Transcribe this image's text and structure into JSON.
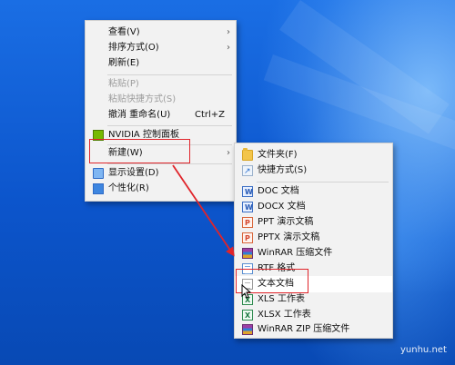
{
  "desktop_menu": {
    "items": [
      {
        "label": "查看(V)",
        "has_submenu": true
      },
      {
        "label": "排序方式(O)",
        "has_submenu": true
      },
      {
        "label": "刷新(E)"
      },
      {
        "label": "粘贴(P)",
        "disabled": true
      },
      {
        "label": "粘贴快捷方式(S)",
        "disabled": true
      },
      {
        "label": "撤消 重命名(U)",
        "shortcut": "Ctrl+Z"
      },
      {
        "label": "NVIDIA 控制面板",
        "icon": "nvidia-icon"
      },
      {
        "label": "新建(W)",
        "has_submenu": true
      },
      {
        "label": "显示设置(D)",
        "icon": "display-icon"
      },
      {
        "label": "个性化(R)",
        "icon": "personalize-icon"
      }
    ]
  },
  "new_submenu": {
    "items": [
      {
        "label": "文件夹(F)",
        "icon": "folder-icon"
      },
      {
        "label": "快捷方式(S)",
        "icon": "shortcut-icon"
      },
      {
        "label": "DOC 文档",
        "icon": "doc-icon"
      },
      {
        "label": "DOCX 文档",
        "icon": "docx-icon"
      },
      {
        "label": "PPT 演示文稿",
        "icon": "ppt-icon"
      },
      {
        "label": "PPTX 演示文稿",
        "icon": "pptx-icon"
      },
      {
        "label": "WinRAR 压缩文件",
        "icon": "winrar-icon"
      },
      {
        "label": "RTF 格式",
        "icon": "rtf-icon"
      },
      {
        "label": "文本文档",
        "icon": "text-document-icon"
      },
      {
        "label": "XLS 工作表",
        "icon": "xls-icon"
      },
      {
        "label": "XLSX 工作表",
        "icon": "xlsx-icon"
      },
      {
        "label": "WinRAR ZIP 压缩文件",
        "icon": "winrar-zip-icon"
      }
    ]
  },
  "watermark": "yunhu.net",
  "colors": {
    "desktop_blue": "#0c55cc",
    "menu_bg": "#f2f2f2",
    "annotation_red": "#e0242a"
  }
}
